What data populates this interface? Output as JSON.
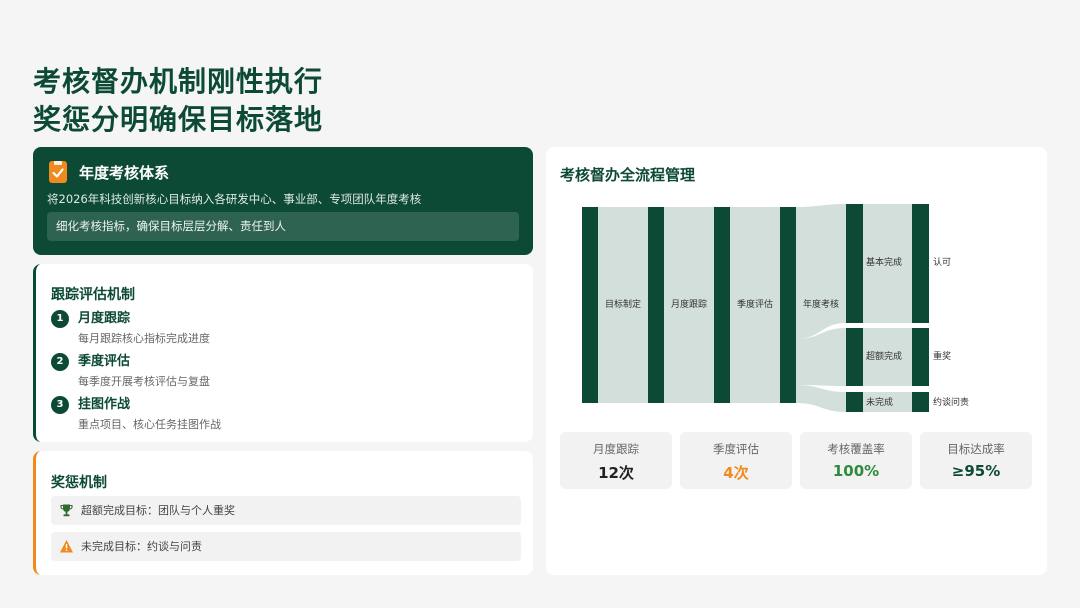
{
  "header": {
    "title_line1": "考核督办机制刚性执行",
    "title_line2": "奖惩分明确保目标落地"
  },
  "annual": {
    "icon": "clipboard-check-icon",
    "title": "年度考核体系",
    "description": "将2026年科技创新核心目标纳入各研发中心、事业部、专项团队年度考核",
    "sub": "细化考核指标，确保目标层层分解、责任到人"
  },
  "tracking": {
    "title": "跟踪评估机制",
    "items": [
      {
        "num": "1",
        "label": "月度跟踪",
        "desc": "每月跟踪核心指标完成进度"
      },
      {
        "num": "2",
        "label": "季度评估",
        "desc": "每季度开展考核评估与复盘"
      },
      {
        "num": "3",
        "label": "挂图作战",
        "desc": "重点项目、核心任务挂图作战"
      }
    ]
  },
  "reward": {
    "title": "奖惩机制",
    "items": [
      {
        "icon": "trophy-icon",
        "text": "超额完成目标：团队与个人重奖"
      },
      {
        "icon": "warning-icon",
        "text": "未完成目标：约谈与问责"
      }
    ]
  },
  "flow": {
    "title": "考核督办全流程管理",
    "stages": [
      "目标制定",
      "月度跟踪",
      "季度评估",
      "年度考核"
    ],
    "outcomes": [
      {
        "grade": "基本完成",
        "result": "认可"
      },
      {
        "grade": "超额完成",
        "result": "重奖"
      },
      {
        "grade": "未完成",
        "result": "约谈问责"
      }
    ]
  },
  "stats": [
    {
      "label": "月度跟踪",
      "value": "12次",
      "color": "#222222"
    },
    {
      "label": "季度评估",
      "value": "4次",
      "color": "#f08a1e"
    },
    {
      "label": "考核覆盖率",
      "value": "100%",
      "color": "#2e8b3e"
    },
    {
      "label": "目标达成率",
      "value": "≥95%",
      "color": "#0d4a35"
    }
  ],
  "colors": {
    "primary": "#0d4a35",
    "accent": "#f08a1e",
    "flow_fill": "#d3dfdb"
  }
}
